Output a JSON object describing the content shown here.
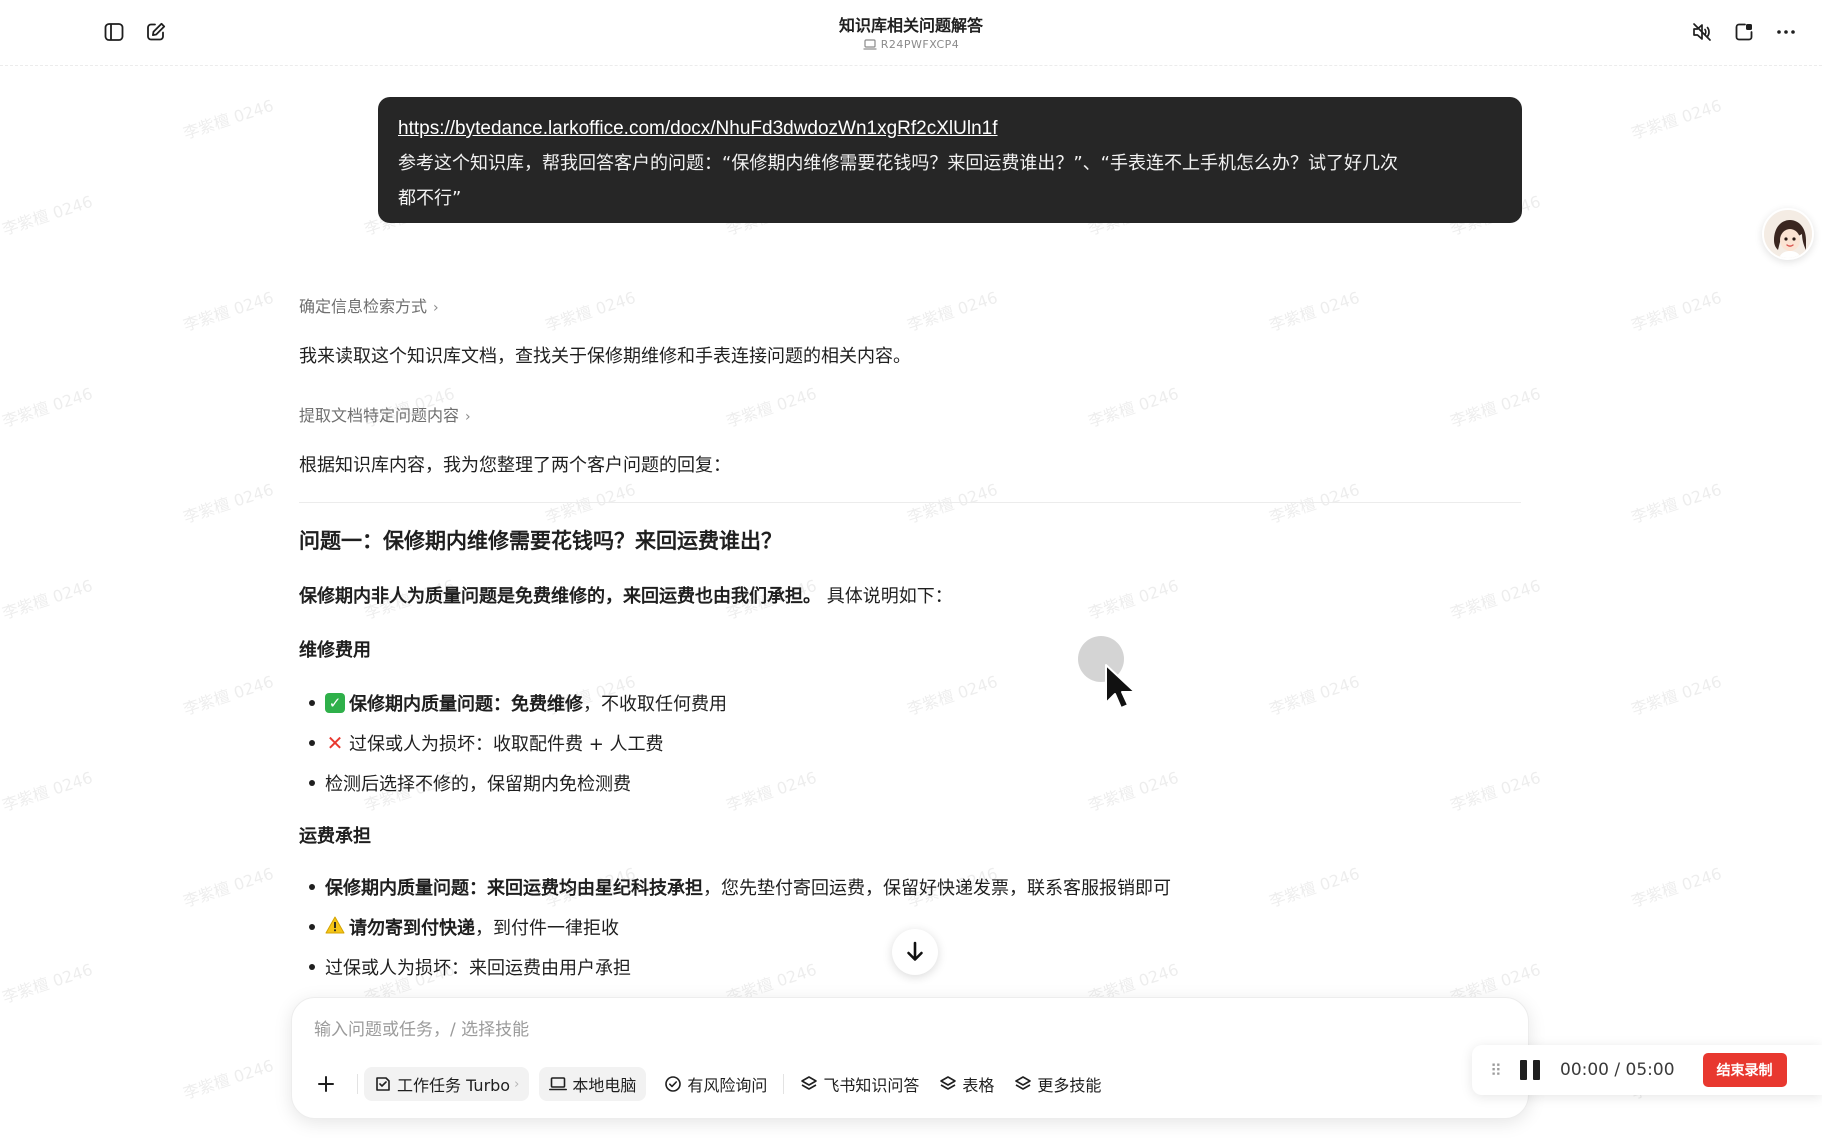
{
  "header": {
    "title": "知识库相关问题解答",
    "device_label": "R24PWFXCP4"
  },
  "watermark": "李紫檀 0246",
  "user_message": {
    "link": "https://bytedance.larkoffice.com/docx/NhuFd3dwdozWn1xgRf2cXlUln1f",
    "line1": "参考这个知识库，帮我回答客户的问题：“保修期内维修需要花钱吗？来回运费谁出？”、“手表连不上手机怎么办？试了好几次",
    "line2": "都不行”"
  },
  "response": {
    "step1": "确定信息检索方式",
    "para1": "我来读取这个知识库文档，查找关于保修期维修和手表连接问题的相关内容。",
    "step2": "提取文档特定问题内容",
    "para2": "根据知识库内容，我为您整理了两个客户问题的回复：",
    "q1_title": "问题一：保修期内维修需要花钱吗？来回运费谁出？",
    "q1_summary_bold": "保修期内非人为质量问题是免费维修的，来回运费也由我们承担。",
    "q1_summary_rest": " 具体说明如下：",
    "repair_heading": "维修费用",
    "repair_items": [
      {
        "bold": "保修期内质量问题：免费维修",
        "rest": "，不收取任何费用"
      },
      {
        "bold": "",
        "rest": "过保或人为损坏：收取配件费 + 人工费"
      },
      {
        "bold": "",
        "rest": "检测后选择不修的，保留期内免检测费"
      }
    ],
    "shipping_heading": "运费承担",
    "shipping_items": [
      {
        "bold": "保修期内质量问题：来回运费均由星纪科技承担",
        "rest": "，您先垫付寄回运费，保留好快递发票，联系客服报销即可"
      },
      {
        "bold": "请勿寄到付快递",
        "rest": "，到付件一律拒收"
      },
      {
        "bold": "",
        "rest": "过保或人为损坏：来回运费由用户承担"
      }
    ]
  },
  "composer": {
    "placeholder": "输入问题或任务，/ 选择技能",
    "tools": {
      "task": "工作任务 Turbo",
      "local": "本地电脑",
      "risk": "有风险询问",
      "knowledge": "飞书知识问答",
      "table": "表格",
      "more": "更多技能"
    }
  },
  "recorder": {
    "time": "00:00  /  05:00",
    "end_label": "结束录制"
  },
  "colors": {
    "bubble_bg": "#262626",
    "end_button": "#e8382f",
    "check_green": "#2fb04a"
  }
}
